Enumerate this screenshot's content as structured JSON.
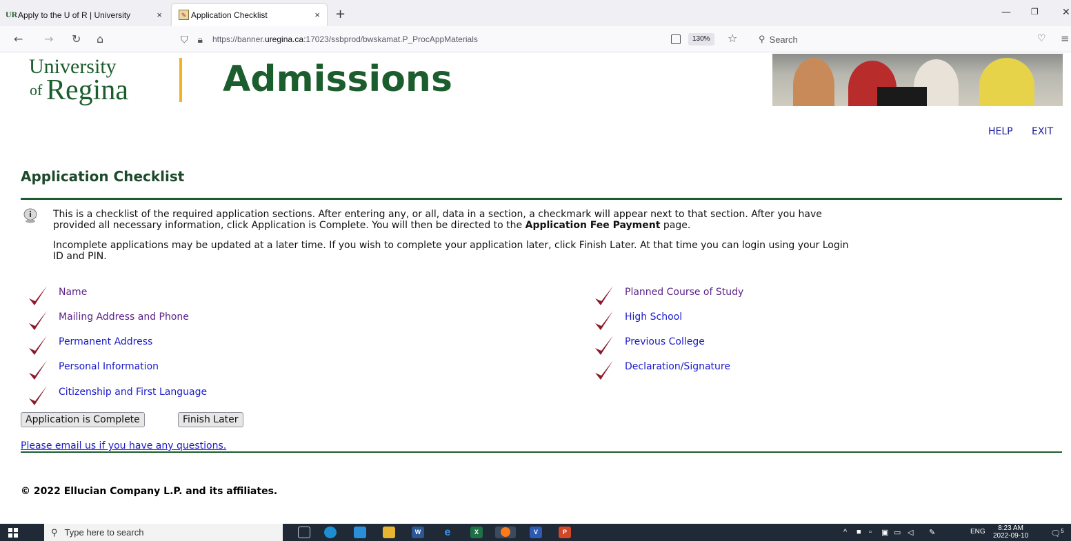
{
  "browser": {
    "tabs": [
      {
        "label": "Apply to the U of R | University",
        "favicon": "UR",
        "active": false
      },
      {
        "label": "Application Checklist",
        "active": true
      }
    ],
    "url": {
      "prefix": "https://banner.",
      "host": "uregina.ca",
      "suffix": ":17023/ssbprod/bwskamat.P_ProcAppMaterials"
    },
    "zoom": "130%",
    "search_placeholder": "Search"
  },
  "header": {
    "logo_line1": "University",
    "logo_line2_small": "of",
    "logo_line2_large": "Regina",
    "title": "Admissions",
    "links": {
      "help": "HELP",
      "exit": "EXIT"
    }
  },
  "page": {
    "title": "Application Checklist",
    "info_text_1a": "This is a checklist of the required application sections. After entering any, or all, data in a section, a checkmark will appear next to that section. After you have",
    "info_text_1b": "provided all necessary information, click Application is Complete. You will then be directed to the",
    "info_text_1_bold": "Application Fee Payment",
    "info_text_1c": "page.",
    "info_text_2a": "Incomplete applications may be updated at a later time. If you wish to complete your application later, click Finish Later. At that time you can login using your Login",
    "info_text_2b": "ID and PIN.",
    "checklist_left": [
      {
        "label": "Name",
        "visited": true
      },
      {
        "label": "Mailing Address and Phone",
        "visited": true
      },
      {
        "label": "Permanent Address",
        "visited": false
      },
      {
        "label": "Personal Information",
        "visited": false
      },
      {
        "label": "Citizenship and First Language",
        "visited": false
      }
    ],
    "checklist_right": [
      {
        "label": "Planned Course of Study",
        "visited": true
      },
      {
        "label": "High School",
        "visited": false
      },
      {
        "label": "Previous College",
        "visited": false
      },
      {
        "label": "Declaration/Signature",
        "visited": false
      }
    ],
    "buttons": {
      "complete": "Application is Complete",
      "finish_later": "Finish Later"
    },
    "email_link": "Please email us if you have any questions.",
    "copyright": "© 2022 Ellucian Company L.P. and its affiliates."
  },
  "taskbar": {
    "search_placeholder": "Type here to search",
    "language": "ENG",
    "time": "8:23 AM",
    "date": "2022-09-10",
    "notification_count": "5"
  },
  "colors": {
    "brand_green": "#1c5d2d",
    "gold": "#f0b323",
    "link_blue": "#1a1acc",
    "link_visited": "#5a1f8a",
    "check_red": "#8b1a2b"
  }
}
